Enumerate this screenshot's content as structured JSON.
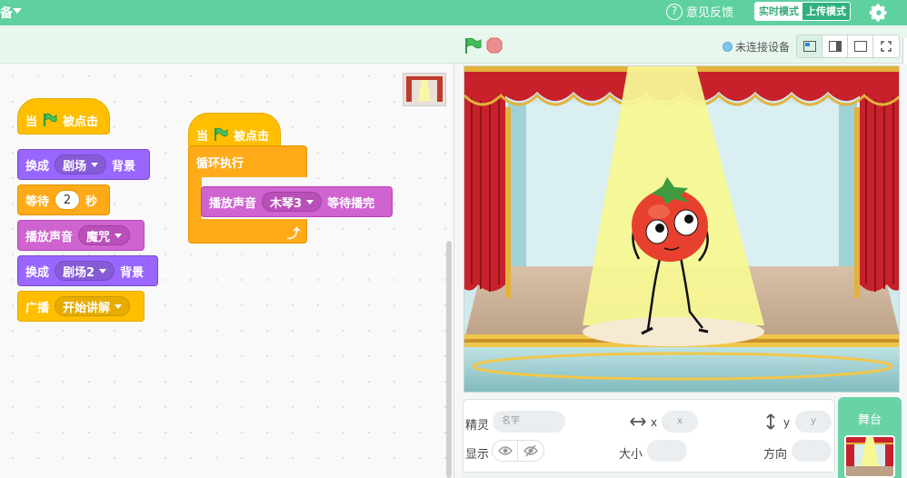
{
  "topbar": {
    "cut_label": "备",
    "help_icon": "question-circle-icon",
    "feedback_label": "意见反馈",
    "mode_realtime": "实时模式",
    "mode_upload": "上传模式",
    "settings_icon": "gear-icon",
    "bg_color": "#5fd0a0"
  },
  "subbar": {
    "start_icon": "green-flag-icon",
    "stop_icon": "stop-icon",
    "connection_status": "未连接设备",
    "layout_icons": [
      "small-stage-icon",
      "large-stage-icon",
      "stage-only-icon",
      "fullscreen-icon"
    ]
  },
  "scripts": {
    "script1": {
      "hat_when": "当",
      "hat_clicked": "被点击",
      "switch1_label": "换成",
      "switch1_value": "剧场",
      "switch1_suffix": "背景",
      "wait_label": "等待",
      "wait_value": "2",
      "wait_unit": "秒",
      "play_label": "播放声音",
      "play_value": "魔咒",
      "switch2_label": "换成",
      "switch2_value": "剧场2",
      "switch2_suffix": "背景",
      "broadcast_label": "广播",
      "broadcast_value": "开始讲解"
    },
    "script2": {
      "hat_when": "当",
      "hat_clicked": "被点击",
      "loop_label": "循环执行",
      "play_until_label": "播放声音",
      "play_until_value": "木琴3",
      "play_until_suffix": "等待播完",
      "loop_arrow": "⤴"
    }
  },
  "sprite_panel": {
    "sprite_label": "精灵",
    "name_placeholder": "名字",
    "x_label": "x",
    "x_placeholder": "x",
    "y_label": "y",
    "y_placeholder": "y",
    "show_label": "显示",
    "size_label": "大小",
    "direction_label": "方向",
    "show_icon": "eye-icon",
    "hide_icon": "eye-slash-icon"
  },
  "stage_panel": {
    "label": "舞台"
  },
  "colors": {
    "events": "#ffbf00",
    "looks": "#9966ff",
    "sound": "#cf63cf",
    "control": "#ffab19"
  }
}
